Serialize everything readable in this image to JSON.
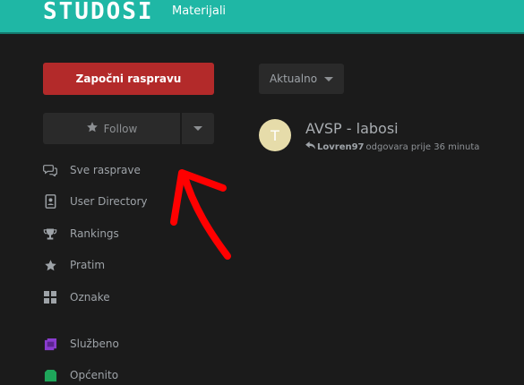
{
  "header": {
    "logo": "STUDOSI",
    "nav_link": "Materijali",
    "color": "#1fb7a5"
  },
  "sidebar": {
    "start_button": "Započni raspravu",
    "start_button_color": "#b32a2a",
    "follow_label": "Follow",
    "items": [
      {
        "label": "Sve rasprave",
        "icon": "comments-icon"
      },
      {
        "label": "User Directory",
        "icon": "address-book-icon"
      },
      {
        "label": "Rankings",
        "icon": "trophy-icon"
      },
      {
        "label": "Pratim",
        "icon": "star-icon"
      },
      {
        "label": "Oznake",
        "icon": "grid-icon"
      },
      {
        "label": "Službeno",
        "icon": "purple-tag-icon"
      },
      {
        "label": "Općenito",
        "icon": "green-tag-icon"
      }
    ]
  },
  "main": {
    "sort_label": "Aktualno",
    "discussions": [
      {
        "avatar_letter": "T",
        "title": "AVSP - labosi",
        "author": "Lovren97",
        "meta_text": "odgovara prije 36 minuta"
      }
    ]
  }
}
